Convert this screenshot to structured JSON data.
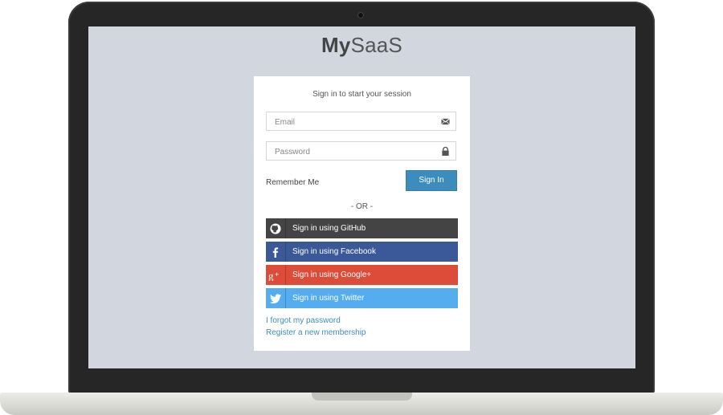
{
  "brand": {
    "bold": "My",
    "light": "SaaS"
  },
  "login": {
    "message": "Sign in to start your session",
    "email_placeholder": "Email",
    "password_placeholder": "Password",
    "remember_label": "Remember Me",
    "signin_label": "Sign In",
    "or_text": "- OR -"
  },
  "social": [
    {
      "label": "Sign in using GitHub",
      "icon": "github-icon",
      "color": "#444444"
    },
    {
      "label": "Sign in using Facebook",
      "icon": "facebook-icon",
      "color": "#3b5998"
    },
    {
      "label": "Sign in using Google+",
      "icon": "google-plus-icon",
      "color": "#dd4b39"
    },
    {
      "label": "Sign in using Twitter",
      "icon": "twitter-icon",
      "color": "#55acee"
    }
  ],
  "links": {
    "forgot": "I forgot my password",
    "register": "Register a new membership"
  },
  "colors": {
    "screen_bg": "#d2d6de",
    "primary": "#3c8dbc"
  }
}
